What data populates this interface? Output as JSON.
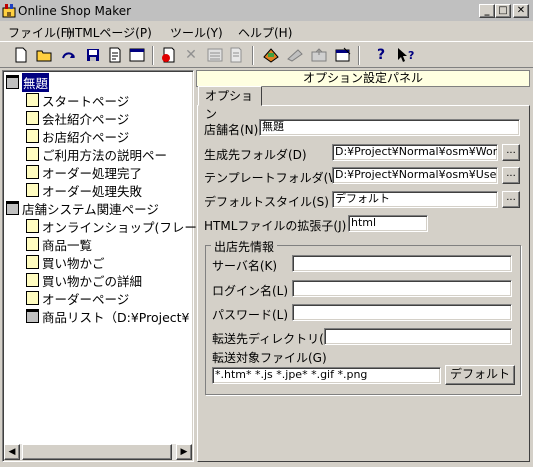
{
  "window": {
    "title": "Online Shop Maker",
    "controls": {
      "minimize": "_",
      "maximize": "□",
      "close": "✕"
    }
  },
  "menu": [
    {
      "label": "ファイル(F)"
    },
    {
      "label": "HTMLページ(P)"
    },
    {
      "label": "ツール(Y)"
    },
    {
      "label": "ヘルプ(H)"
    }
  ],
  "toolbar": {
    "icons": [
      "new-file-icon",
      "open-folder-icon",
      "redo-icon",
      "save-icon",
      "edit-page-icon",
      "window-icon",
      "add-page-icon",
      "delete-icon",
      "list-icon",
      "preview-icon",
      "build-icon",
      "link-icon",
      "upload-icon",
      "properties-icon",
      "help-icon",
      "context-help-icon"
    ]
  },
  "tree": {
    "nodes": [
      {
        "label": "無題",
        "level": 0,
        "type": "folder",
        "selected": true
      },
      {
        "label": "スタートページ",
        "level": 1,
        "type": "page"
      },
      {
        "label": "会社紹介ページ",
        "level": 1,
        "type": "page"
      },
      {
        "label": "お店紹介ページ",
        "level": 1,
        "type": "page"
      },
      {
        "label": "ご利用方法の説明ペー",
        "level": 1,
        "type": "page"
      },
      {
        "label": "オーダー処理完了",
        "level": 1,
        "type": "page"
      },
      {
        "label": "オーダー処理失敗",
        "level": 1,
        "type": "page"
      },
      {
        "label": "店舗システム関連ページ",
        "level": 0,
        "type": "folder"
      },
      {
        "label": "オンラインショップ(フレー",
        "level": 1,
        "type": "page"
      },
      {
        "label": "商品一覧",
        "level": 1,
        "type": "page"
      },
      {
        "label": "買い物かご",
        "level": 1,
        "type": "page"
      },
      {
        "label": "買い物かごの詳細",
        "level": 1,
        "type": "page"
      },
      {
        "label": "オーダーページ",
        "level": 1,
        "type": "page"
      },
      {
        "label": "商品リスト（D:¥Project¥",
        "level": 1,
        "type": "folder"
      }
    ]
  },
  "panel": {
    "title": "オプション設定パネル",
    "tab": "オプション",
    "fields": {
      "shop_name": {
        "label": "店舗名(N)",
        "value": "無題"
      },
      "output_folder": {
        "label": "生成先フォルダ(D)",
        "value": "D:¥Project¥Normal¥osm¥Work¥"
      },
      "template_folder": {
        "label": "テンプレートフォルダ(W)",
        "value": "D:¥Project¥Normal¥osm¥Userfil"
      },
      "default_style": {
        "label": "デフォルトスタイル(S)",
        "value": "デフォルト"
      },
      "html_ext": {
        "label": "HTMLファイルの拡張子(J)",
        "value": "html"
      }
    },
    "browse_label": "...",
    "group": {
      "title": "出店先情報",
      "server": {
        "label": "サーバ名(K)",
        "value": ""
      },
      "login": {
        "label": "ログイン名(L)",
        "value": ""
      },
      "password": {
        "label": "パスワード(L)",
        "value": ""
      },
      "transfer_dir": {
        "label": "転送先ディレクトリ(R)",
        "value": ""
      },
      "transfer_files": {
        "label": "転送対象ファイル(G)",
        "value": "*.htm* *.js *.jpe* *.gif *.png"
      },
      "default_button": "デフォルト"
    }
  }
}
